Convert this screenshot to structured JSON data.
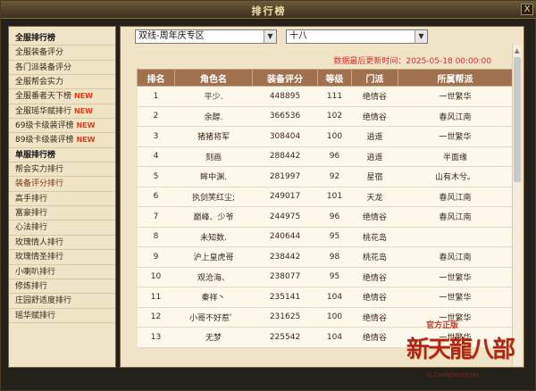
{
  "window": {
    "title": "排行榜",
    "close_label": "X"
  },
  "sidebar": {
    "items": [
      {
        "label": "全服排行榜",
        "type": "category",
        "new": false
      },
      {
        "label": "全服装备评分",
        "type": "item",
        "new": false
      },
      {
        "label": "各门派装备评分",
        "type": "item",
        "new": false
      },
      {
        "label": "全服帮会实力",
        "type": "item",
        "new": false
      },
      {
        "label": "全服番者天下榜",
        "type": "item",
        "new": true
      },
      {
        "label": "全服瑶华赋排行",
        "type": "item",
        "new": true
      },
      {
        "label": "69级卡级装评榜",
        "type": "item",
        "new": true
      },
      {
        "label": "89级卡级装评榜",
        "type": "item",
        "new": true
      },
      {
        "label": "单服排行榜",
        "type": "category",
        "new": false
      },
      {
        "label": "帮会实力排行",
        "type": "item",
        "new": false
      },
      {
        "label": "装备评分排行",
        "type": "item",
        "new": false
      },
      {
        "label": "高手排行",
        "type": "item",
        "new": false
      },
      {
        "label": "富豪排行",
        "type": "item",
        "new": false
      },
      {
        "label": "心法排行",
        "type": "item",
        "new": false
      },
      {
        "label": "玫瑰情人排行",
        "type": "item",
        "new": false
      },
      {
        "label": "玫瑰情圣排行",
        "type": "item",
        "new": false
      },
      {
        "label": "小喇叭排行",
        "type": "item",
        "new": false
      },
      {
        "label": "修炼排行",
        "type": "item",
        "new": false
      },
      {
        "label": "庄园舒适度排行",
        "type": "item",
        "new": false
      },
      {
        "label": "瑶华赋排行",
        "type": "item",
        "new": false
      }
    ],
    "new_label": "NEW"
  },
  "filters": {
    "server_group": "双线-周年庆专区",
    "server": "十八"
  },
  "update_time": "数据最后更新时间：2025-05-18 00:00:00",
  "table": {
    "columns": [
      "排名",
      "角色名",
      "装备评分",
      "等级",
      "门派",
      "所属帮派"
    ],
    "rows": [
      [
        "1",
        "平少.",
        "448895",
        "111",
        "绝情谷",
        "一世繁华"
      ],
      [
        "2",
        "余醇.",
        "366536",
        "102",
        "绝情谷",
        "春风江南"
      ],
      [
        "3",
        "猪猪将军",
        "308404",
        "100",
        "逍遥",
        "一世繁华"
      ],
      [
        "4",
        "刻画",
        "288442",
        "96",
        "逍遥",
        "半面缘"
      ],
      [
        "5",
        "眸中渊.",
        "281997",
        "92",
        "星宿",
        "山有木兮。"
      ],
      [
        "6",
        "执剑笑红尘;",
        "249017",
        "101",
        "天龙",
        "春风江南"
      ],
      [
        "7",
        "巅峰、少爷",
        "244975",
        "96",
        "绝情谷",
        "春风江南"
      ],
      [
        "8",
        "未知数.",
        "240644",
        "95",
        "桃花岛",
        ""
      ],
      [
        "9",
        "沪上皇虎哥",
        "238442",
        "98",
        "桃花岛",
        "春风江南"
      ],
      [
        "10",
        "观沧海、",
        "238077",
        "95",
        "绝情谷",
        "一世繁华"
      ],
      [
        "11",
        "秦祥丶",
        "235141",
        "104",
        "绝情谷",
        "一世繁华"
      ],
      [
        "12",
        "小哥不好惹゜",
        "231625",
        "100",
        "绝情谷",
        "一世繁华"
      ],
      [
        "13",
        "无梦",
        "225542",
        "104",
        "绝情谷",
        "一世繁华"
      ]
    ]
  },
  "logo": {
    "title": "新天龍八部",
    "subtitle": "官方正版",
    "url": "TL.CHANGYOU.COM"
  },
  "colors": {
    "header_bg": "#a0714e",
    "panel_bg": "#efe4c6",
    "update_text": "#e02c2c",
    "new_badge": "#e23a1a"
  }
}
